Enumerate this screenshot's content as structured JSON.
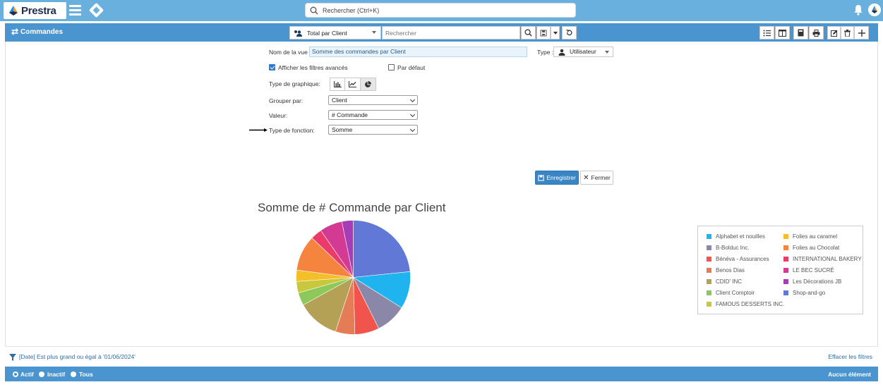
{
  "topbar": {
    "brand": "Prestra",
    "search_placeholder": "Rechercher (Ctrl+K)"
  },
  "titlebar": {
    "title": "Commandes",
    "view_selected": "Total par Client",
    "search_placeholder": "Rechercher"
  },
  "form": {
    "view_name_label": "Nom de la vue :",
    "view_name_value": "Somme des commandes par Client",
    "type_label": "Type :",
    "type_value": "Utilisateur",
    "advanced_filters_label": "Afficher les filtres avancés",
    "advanced_filters_checked": true,
    "default_label": "Par défaut",
    "default_checked": false,
    "chart_type_label": "Type de graphique:",
    "chart_type_selected": "pie",
    "group_by_label": "Grouper par:",
    "group_by_value": "Client",
    "value_label": "Valeur:",
    "value_value": "# Commande",
    "function_label": "Type de fonction:",
    "function_value": "Somme",
    "save_label": "Enregistrer",
    "close_label": "Fermer"
  },
  "chart_data": {
    "type": "pie",
    "title": "Somme de # Commande par Client",
    "legend_position": "right",
    "slices": [
      {
        "name": "Shop-and-go",
        "value": 25.5,
        "color": "#6278d6"
      },
      {
        "name": "Alphabet et nouilles",
        "value": 11.5,
        "color": "#1fb3f0"
      },
      {
        "name": "B-Bolduc Inc.",
        "value": 9.5,
        "color": "#8a87a8"
      },
      {
        "name": "Bénéva - Assurances",
        "value": 7.5,
        "color": "#f0544c"
      },
      {
        "name": "Benos Dias",
        "value": 6.0,
        "color": "#e47d55"
      },
      {
        "name": "CDID' INC",
        "value": 13.0,
        "color": "#b5a156"
      },
      {
        "name": "Client Comptoir",
        "value": 4.0,
        "color": "#8cc85a"
      },
      {
        "name": "FAMOUS DESSERTS INC.",
        "value": 3.5,
        "color": "#c9c83d"
      },
      {
        "name": "Folies au caramel",
        "value": 3.5,
        "color": "#f5bf2a"
      },
      {
        "name": "Folies au Chocolat",
        "value": 11.0,
        "color": "#f5843e"
      },
      {
        "name": "INTERNATIONAL BAKERY",
        "value": 3.5,
        "color": "#ec3b6b"
      },
      {
        "name": "LE BEC SUCRÉ",
        "value": 7.0,
        "color": "#d23a94"
      },
      {
        "name": "Les Décorations JB",
        "value": 3.5,
        "color": "#a63db6"
      }
    ],
    "legend_left": [
      {
        "name": "Alphabet et nouilles",
        "color": "#1fb3f0"
      },
      {
        "name": "B-Bolduc Inc.",
        "color": "#8a87a8"
      },
      {
        "name": "Bénéva - Assurances",
        "color": "#f0544c"
      },
      {
        "name": "Benos Dias",
        "color": "#e47d55"
      },
      {
        "name": "CDID' INC",
        "color": "#b5a156"
      },
      {
        "name": "Client Comptoir",
        "color": "#8cc85a"
      },
      {
        "name": "FAMOUS DESSERTS INC.",
        "color": "#c9c83d"
      }
    ],
    "legend_right": [
      {
        "name": "Folies au caramel",
        "color": "#f5bf2a"
      },
      {
        "name": "Folies au Chocolat",
        "color": "#f5843e"
      },
      {
        "name": "INTERNATIONAL BAKERY",
        "color": "#ec3b6b"
      },
      {
        "name": "LE BEC SUCRÉ",
        "color": "#d23a94"
      },
      {
        "name": "Les Décorations JB",
        "color": "#a63db6"
      },
      {
        "name": "Shop-and-go",
        "color": "#6278d6"
      }
    ]
  },
  "filterbar": {
    "filter_text": "[Date] Est plus grand ou égal à '01/06/2024'",
    "clear_label": "Effacer les filtres"
  },
  "statusbar": {
    "actif": "Actif",
    "inactif": "Inactif",
    "tous": "Tous",
    "selected": "Actif",
    "count_text": "Aucun élément"
  },
  "colors": {
    "topbar": "#6ab0df",
    "titlebar": "#4a95cf",
    "accent": "#3a86c5"
  }
}
